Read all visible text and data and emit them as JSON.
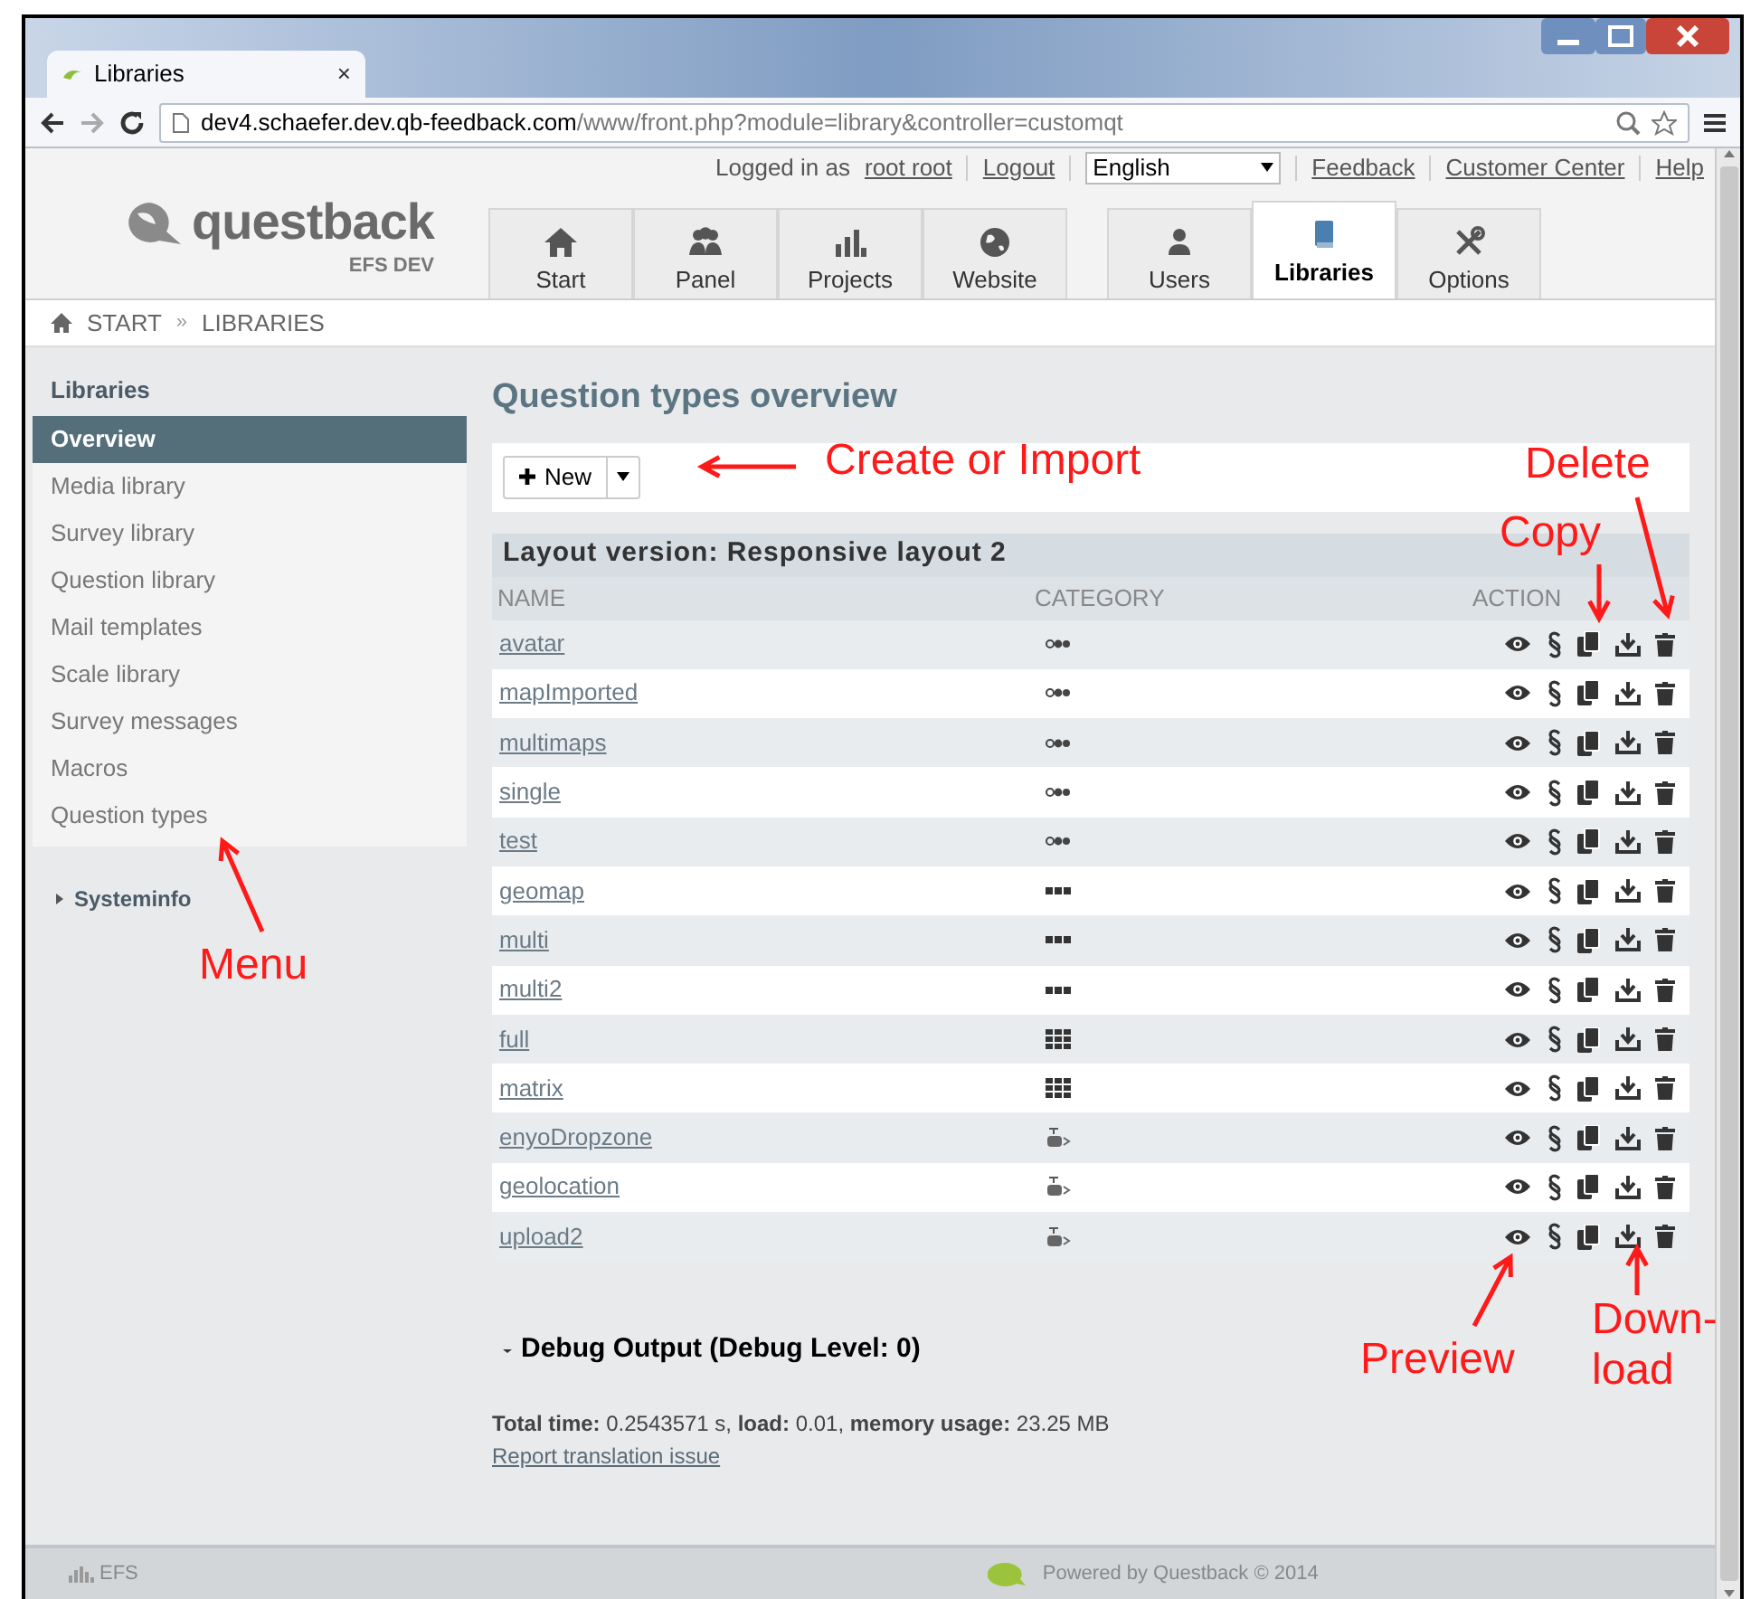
{
  "browser": {
    "tab_title": "Libraries",
    "tab_close": "×",
    "url_host": "dev4.schaefer.dev.qb-feedback.com",
    "url_path": "/www/front.php?module=library&controller=customqt"
  },
  "header": {
    "logged_in_label": "Logged in as",
    "user": "root root",
    "logout": "Logout",
    "language": "English",
    "links": [
      "Feedback",
      "Customer Center",
      "Help"
    ],
    "logo": "questback",
    "logo_sub": "EFS DEV",
    "nav_main": [
      {
        "label": "Start",
        "kind": "home",
        "selected": false
      },
      {
        "label": "Panel",
        "kind": "people",
        "selected": false
      },
      {
        "label": "Projects",
        "kind": "chart",
        "selected": false
      },
      {
        "label": "Website",
        "kind": "globe",
        "selected": false
      }
    ],
    "nav_admin": [
      {
        "label": "Users",
        "kind": "user",
        "selected": false
      },
      {
        "label": "Libraries",
        "kind": "book",
        "selected": true
      },
      {
        "label": "Options",
        "kind": "tools",
        "selected": false
      }
    ]
  },
  "breadcrumb": {
    "items": [
      "START",
      "LIBRARIES"
    ],
    "separator": "»"
  },
  "sidebar": {
    "title": "Libraries",
    "items": [
      {
        "label": "Overview",
        "selected": true
      },
      {
        "label": "Media library",
        "selected": false
      },
      {
        "label": "Survey library",
        "selected": false
      },
      {
        "label": "Question library",
        "selected": false
      },
      {
        "label": "Mail templates",
        "selected": false
      },
      {
        "label": "Scale library",
        "selected": false
      },
      {
        "label": "Survey messages",
        "selected": false
      },
      {
        "label": "Macros",
        "selected": false
      },
      {
        "label": "Question types",
        "selected": false
      }
    ],
    "systeminfo": {
      "label": "Systeminfo",
      "expanded": false
    }
  },
  "main": {
    "title": "Question types overview",
    "new_button": "New",
    "layout_heading": "Layout version: Responsive layout 2",
    "columns": [
      "NAME",
      "CATEGORY",
      "ACTION"
    ],
    "rows": [
      {
        "name": "avatar",
        "kind": "single"
      },
      {
        "name": "mapImported",
        "kind": "single"
      },
      {
        "name": "multimaps",
        "kind": "single"
      },
      {
        "name": "single",
        "kind": "single"
      },
      {
        "name": "test",
        "kind": "single"
      },
      {
        "name": "geomap",
        "kind": "multi"
      },
      {
        "name": "multi",
        "kind": "multi"
      },
      {
        "name": "multi2",
        "kind": "multi"
      },
      {
        "name": "full",
        "kind": "matrix"
      },
      {
        "name": "matrix",
        "kind": "matrix"
      },
      {
        "name": "enyoDropzone",
        "kind": "upload"
      },
      {
        "name": "geolocation",
        "kind": "upload"
      },
      {
        "name": "upload2",
        "kind": "upload"
      }
    ],
    "debug": {
      "label": "Debug Output (Debug Level: 0)",
      "expanded": false
    },
    "stats": "**Total time:** 0.2543571 s, **load:** 0.01, **memory usage:** 23.25 MB",
    "report_link": "Report translation issue"
  },
  "footer": {
    "logo": "EFS",
    "powered": "Powered by Questback © 2014"
  },
  "annotations": [
    "Create or Import",
    "Delete",
    "Copy",
    "Menu",
    "Preview",
    "Down-\nload"
  ]
}
